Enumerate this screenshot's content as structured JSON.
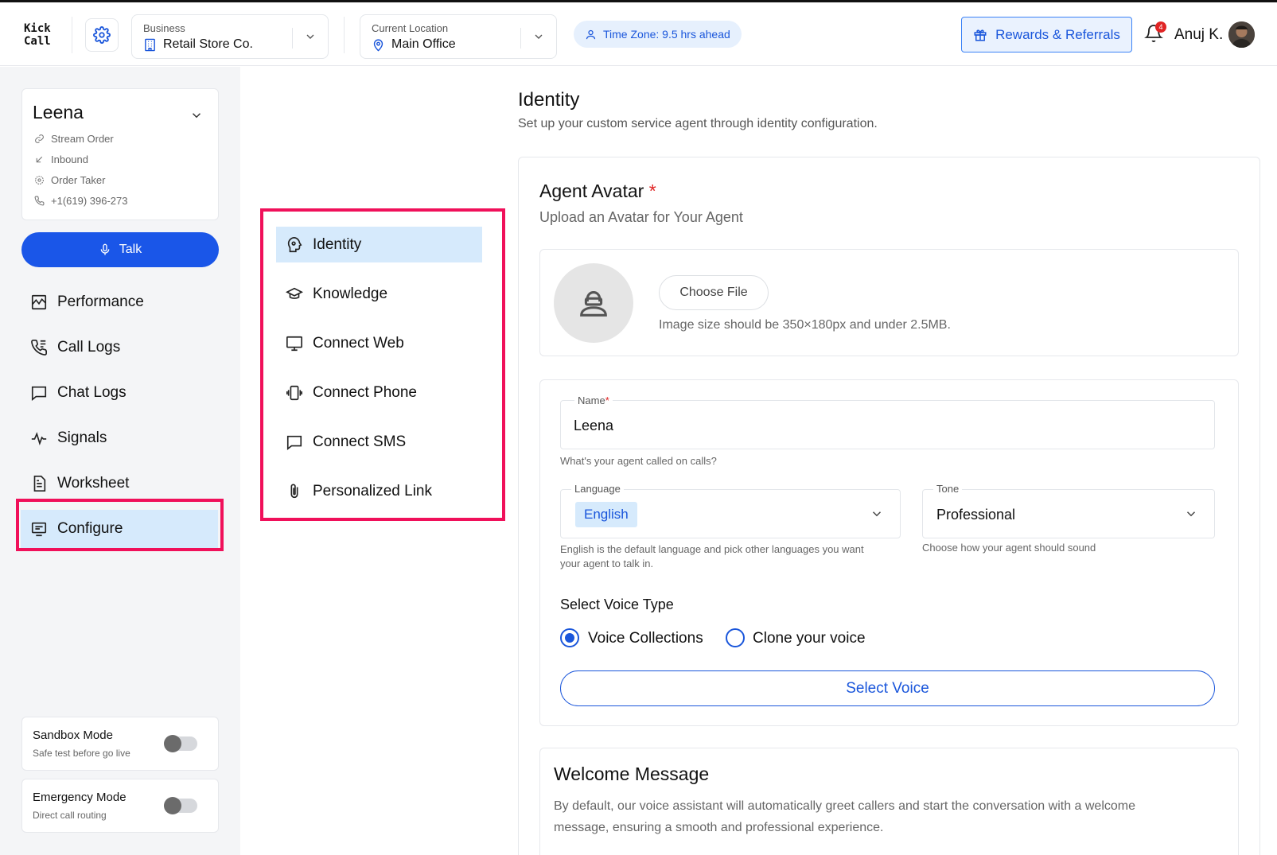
{
  "app": {
    "logo_line1": "Kick",
    "logo_line2": "Call"
  },
  "header": {
    "business": {
      "label": "Business",
      "value": "Retail Store Co."
    },
    "location": {
      "label": "Current Location",
      "value": "Main Office"
    },
    "timezone": "Time Zone: 9.5 hrs ahead",
    "rewards_label": "Rewards & Referrals",
    "notification_count": "4",
    "user_name": "Anuj K."
  },
  "agent": {
    "name": "Leena",
    "meta": [
      {
        "icon": "link-icon",
        "text": "Stream Order"
      },
      {
        "icon": "inbound-arrow-icon",
        "text": "Inbound"
      },
      {
        "icon": "settings-icon",
        "text": "Order Taker"
      },
      {
        "icon": "phone-icon",
        "text": "+1(619) 396-273"
      }
    ]
  },
  "talk_label": "Talk",
  "nav": [
    {
      "label": "Performance",
      "icon": "chart-icon"
    },
    {
      "label": "Call Logs",
      "icon": "call-logs-icon"
    },
    {
      "label": "Chat Logs",
      "icon": "chat-icon"
    },
    {
      "label": "Signals",
      "icon": "pulse-icon"
    },
    {
      "label": "Worksheet",
      "icon": "document-icon"
    },
    {
      "label": "Configure",
      "icon": "configure-icon",
      "active": true
    }
  ],
  "modes": [
    {
      "title": "Sandbox Mode",
      "subtitle": "Safe test before go live",
      "enabled": false
    },
    {
      "title": "Emergency Mode",
      "subtitle": "Direct call routing",
      "enabled": false
    }
  ],
  "subnav": [
    {
      "label": "Identity",
      "icon": "identity-icon",
      "active": true
    },
    {
      "label": "Knowledge",
      "icon": "graduation-cap-icon"
    },
    {
      "label": "Connect Web",
      "icon": "monitor-icon"
    },
    {
      "label": "Connect Phone",
      "icon": "phone-vibrate-icon"
    },
    {
      "label": "Connect SMS",
      "icon": "message-icon"
    },
    {
      "label": "Personalized Link",
      "icon": "paperclip-icon"
    }
  ],
  "content": {
    "title": "Identity",
    "subtitle": "Set up your custom service agent through identity configuration.",
    "avatar_section": {
      "title": "Agent Avatar",
      "required_mark": "*",
      "subtitle": "Upload an Avatar for Your Agent",
      "choose_file": "Choose File",
      "hint": "Image size should be 350×180px and under 2.5MB."
    },
    "name_field": {
      "label": "Name",
      "required_mark": "*",
      "value": "Leena",
      "helper": "What's your agent called on calls?"
    },
    "language_field": {
      "label": "Language",
      "value": "English",
      "helper_line1": "English is the default language and pick other languages you want",
      "helper_line2": "your agent to talk in."
    },
    "tone_field": {
      "label": "Tone",
      "value": "Professional",
      "helper": "Choose how your agent should sound"
    },
    "voice_type": {
      "title": "Select Voice Type",
      "options": [
        "Voice Collections",
        "Clone your voice"
      ],
      "selected": "Voice Collections",
      "select_button": "Select Voice"
    },
    "welcome": {
      "title": "Welcome Message",
      "text": "By default, our voice assistant will automatically greet callers and start the conversation with a welcome message, ensuring a smooth and professional experience."
    }
  },
  "colors": {
    "accent": "#1a56db",
    "highlight": "#f0105a",
    "active_bg": "#d6eafc"
  }
}
